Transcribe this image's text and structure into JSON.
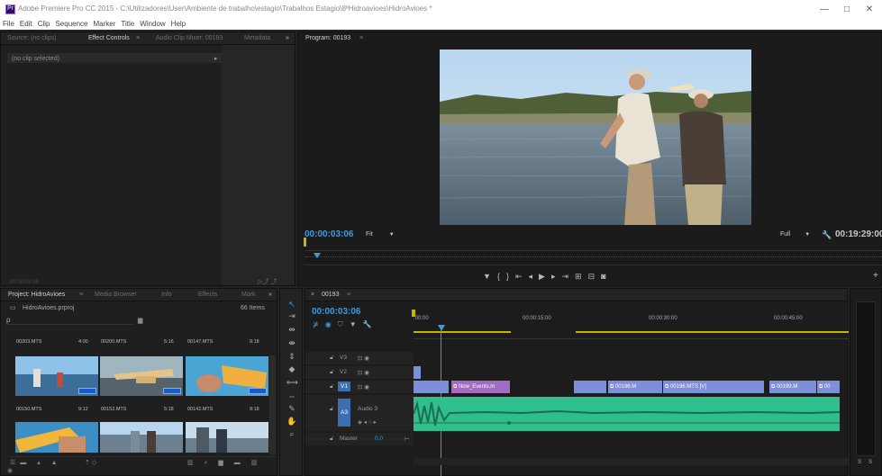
{
  "window": {
    "title": "Adobe Premiere Pro CC 2015 - C:\\Utilizadores\\User\\Ambiente de trabalho\\estagio\\Trabalhos Estagio\\8ºHidroavioes\\HidroAvioes *",
    "app_logo_text": "Pr",
    "minimize": "—",
    "maximize": "□",
    "close": "✕"
  },
  "menu": [
    "File",
    "Edit",
    "Clip",
    "Sequence",
    "Marker",
    "Title",
    "Window",
    "Help"
  ],
  "source_panel": {
    "tabs": [
      "Source: (no clips)",
      "Effect Controls",
      "Audio Clip Mixer: 00193",
      "Metadata"
    ],
    "overflow": "»",
    "no_clip": "(no clip selected)",
    "timecode": "00:00:03:06"
  },
  "program_monitor": {
    "tab": "Program: 00193",
    "timecode": "00:00:03:06",
    "fit": "Fit",
    "full": "Full",
    "duration": "00:19:29:00",
    "plus": "+"
  },
  "project": {
    "tabs": [
      "Project: HidroAvioes",
      "Media Browser",
      "Info",
      "Effects",
      "Mark"
    ],
    "overflow": "»",
    "file": "HidroAvioes.prproj",
    "item_count": "66 Items",
    "search_placeholder": "ρ",
    "clips": [
      {
        "name": "00203.MTS",
        "duration": "4:00"
      },
      {
        "name": "00200.MTS",
        "duration": "5:16"
      },
      {
        "name": "00147.MTS",
        "duration": "9:18"
      },
      {
        "name": "00150.MTS",
        "duration": "9:12"
      },
      {
        "name": "00152.MTS",
        "duration": "5:18"
      },
      {
        "name": "00142.MTS",
        "duration": "9:18"
      }
    ]
  },
  "timeline": {
    "tab": "00193",
    "timecode": "00:00:03:06",
    "ruler": [
      ":00:00",
      "00:00:15:00",
      "00:00:30:00",
      "00:00:45:00"
    ],
    "tracks": [
      {
        "id": "V3"
      },
      {
        "id": "V2"
      },
      {
        "id": "V1"
      },
      {
        "id": "A3",
        "name": "Audio 3"
      }
    ],
    "master": {
      "label": "Master",
      "value": "0,0"
    },
    "clips": [
      "Now_Events.m",
      "00196.M",
      "00196.MTS [V]",
      "00199.M",
      "00"
    ]
  },
  "meter": {
    "labels": [
      "S",
      "S"
    ]
  },
  "colors": {
    "timecode_blue": "#3c9be0",
    "video_clip": "#7d8fd8",
    "nested_clip": "#a26bc4",
    "audio_clip": "#2fbf8c",
    "work_area": "#c8b400"
  }
}
